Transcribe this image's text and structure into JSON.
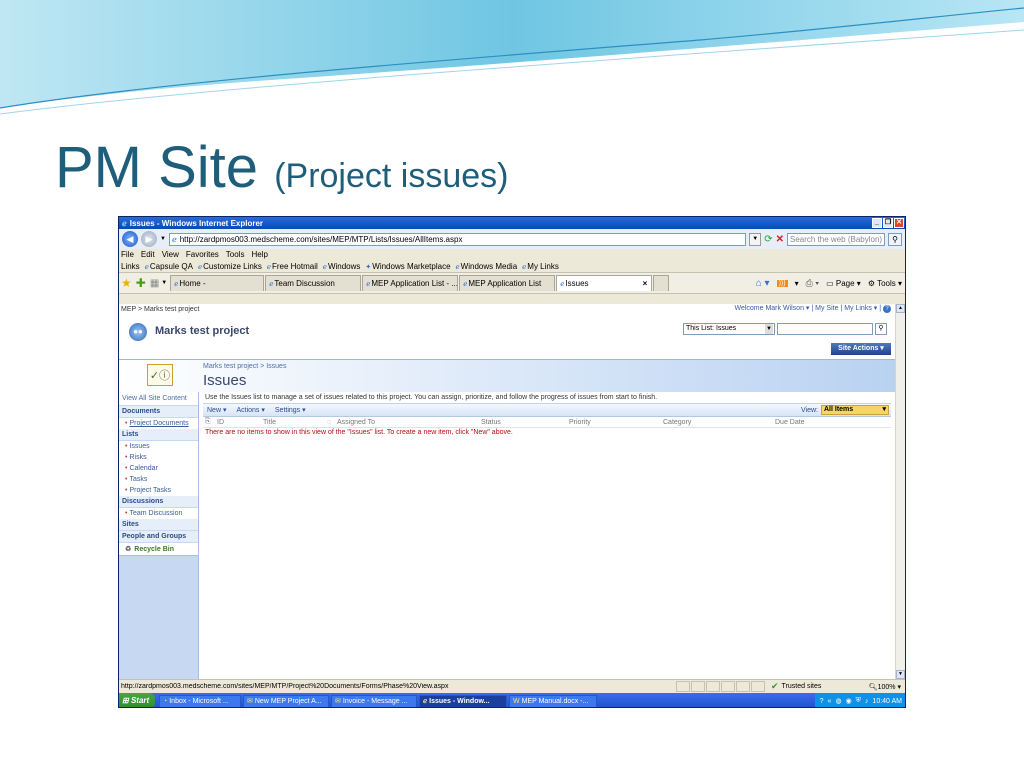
{
  "slide": {
    "title": "PM Site",
    "subtitle": "(Project issues)"
  },
  "browser": {
    "window_title": "Issues - Windows Internet Explorer",
    "url": "http://zardpmos003.medscheme.com/sites/MEP/MTP/Lists/Issues/AllItems.aspx",
    "search_placeholder": "Search the web (Babylon)",
    "menu": [
      "File",
      "Edit",
      "View",
      "Favorites",
      "Tools",
      "Help"
    ],
    "links_label": "Links",
    "links": [
      "Capsule QA",
      "Customize Links",
      "Free Hotmail",
      "Windows",
      "Windows Marketplace",
      "Windows Media",
      "My Links"
    ],
    "tabs": [
      "Home -",
      "Team Discussion",
      "MEP Application List - ...",
      "MEP Application List",
      "Issues"
    ],
    "active_tab_index": 4,
    "commands": {
      "page": "Page",
      "tools": "Tools"
    }
  },
  "sharepoint": {
    "breadcrumb": "MEP > Marks test project",
    "welcome": "Welcome Mark Wilson ▾",
    "my_site": "My Site",
    "my_links": "My Links ▾",
    "site_title": "Marks test project",
    "search_scope": "This List: Issues",
    "site_actions": "Site Actions ▾",
    "list_breadcrumb": "Marks test project > Issues",
    "list_title": "Issues",
    "description": "Use the Issues list to manage a set of issues related to this project. You can assign, prioritize, and follow the progress of issues from start to finish.",
    "toolbar": {
      "new": "New ▾",
      "actions": "Actions ▾",
      "settings": "Settings ▾",
      "view_label": "View:",
      "view_value": "All Items"
    },
    "columns": [
      "ID",
      "Title",
      "Assigned To",
      "Status",
      "Priority",
      "Category",
      "Due Date"
    ],
    "empty_message": "There are no items to show in this view of the \"Issues\" list. To create a new item, click \"New\" above.",
    "quicklaunch": {
      "view_all": "View All Site Content",
      "documents_heading": "Documents",
      "documents": [
        "Project Documents"
      ],
      "lists_heading": "Lists",
      "lists": [
        "Issues",
        "Risks",
        "Calendar",
        "Tasks",
        "Project Tasks"
      ],
      "discussions_heading": "Discussions",
      "discussions": [
        "Team Discussion"
      ],
      "sites_heading": "Sites",
      "people_heading": "People and Groups",
      "recycle_bin": "Recycle Bin"
    }
  },
  "statusbar": {
    "url": "http://zardpmos003.medscheme.com/sites/MEP/MTP/Project%20Documents/Forms/Phase%20View.aspx",
    "zone": "Trusted sites",
    "zoom": "100%"
  },
  "taskbar": {
    "start": "Start",
    "items": [
      "Inbox - Microsoft ...",
      "New MEP Project A...",
      "Invoice - Message ...",
      "Issues - Window...",
      "MEP Manual.docx -..."
    ],
    "active_index": 3,
    "clock": "10:40 AM"
  }
}
